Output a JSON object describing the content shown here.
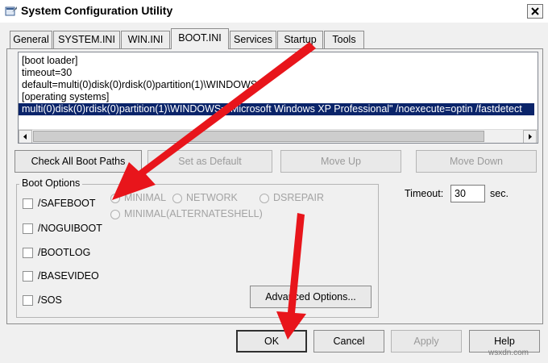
{
  "window": {
    "title": "System Configuration Utility",
    "close_label": "close-icon"
  },
  "tabs": [
    "General",
    "SYSTEM.INI",
    "WIN.INI",
    "BOOT.INI",
    "Services",
    "Startup",
    "Tools"
  ],
  "active_tab": "BOOT.INI",
  "boot_ini": {
    "lines": [
      "[boot loader]",
      "timeout=30",
      "default=multi(0)disk(0)rdisk(0)partition(1)\\WINDOWS",
      "[operating systems]"
    ],
    "selected_line": "multi(0)disk(0)rdisk(0)partition(1)\\WINDOWS=\"Microsoft Windows XP Professional\" /noexecute=optin /fastdetect"
  },
  "boot_buttons": {
    "check_all": "Check All Boot Paths",
    "set_default": "Set as Default",
    "move_up": "Move Up",
    "move_down": "Move Down"
  },
  "boot_options": {
    "title": "Boot Options",
    "checkboxes": [
      "/SAFEBOOT",
      "/NOGUIBOOT",
      "/BOOTLOG",
      "/BASEVIDEO",
      "/SOS"
    ],
    "radios": [
      "MINIMAL",
      "NETWORK",
      "DSREPAIR",
      "MINIMAL(ALTERNATESHELL)"
    ],
    "advanced": "Advanced Options..."
  },
  "timeout": {
    "label": "Timeout:",
    "value": "30",
    "unit": "sec."
  },
  "footer": {
    "ok": "OK",
    "cancel": "Cancel",
    "apply": "Apply",
    "help": "Help"
  },
  "watermark": "wsxdn.com",
  "colors": {
    "annotation_arrow": "#e8151b",
    "selection": "#0a246a"
  }
}
